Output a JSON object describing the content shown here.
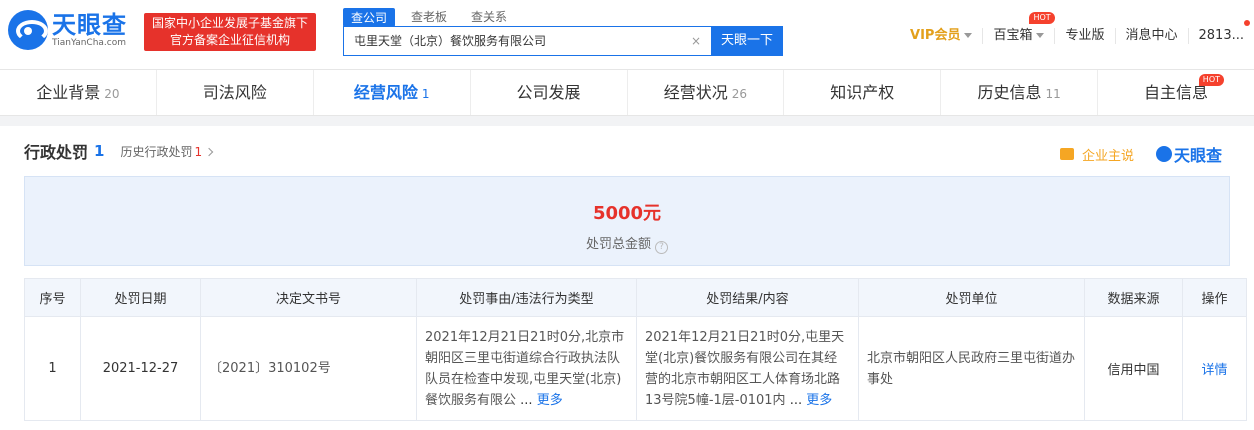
{
  "brand": {
    "name_cn": "天眼查",
    "name_en": "TianYanCha.com",
    "badge_line1": "国家中小企业发展子基金旗下",
    "badge_line2": "官方备案企业征信机构"
  },
  "search": {
    "tabs": [
      "查公司",
      "查老板",
      "查关系"
    ],
    "value": "屯里天堂（北京）餐饮服务有限公司",
    "button": "天眼一下",
    "clear": "×"
  },
  "topnav": {
    "vip": "VIP会员",
    "treasure": "百宝箱",
    "hot": "HOT",
    "pro": "专业版",
    "messages": "消息中心",
    "user": "2813..."
  },
  "tabs": [
    {
      "label": "企业背景",
      "count": "20"
    },
    {
      "label": "司法风险",
      "count": ""
    },
    {
      "label": "经营风险",
      "count": "1"
    },
    {
      "label": "公司发展",
      "count": ""
    },
    {
      "label": "经营状况",
      "count": "26"
    },
    {
      "label": "知识产权",
      "count": ""
    },
    {
      "label": "历史信息",
      "count": "11"
    },
    {
      "label": "自主信息",
      "count": ""
    }
  ],
  "section": {
    "title": "行政处罚",
    "count": "1",
    "history_label": "历史行政处罚",
    "history_count": "1",
    "ent_say": "企业主说",
    "logo": "天眼查"
  },
  "summary": {
    "amount": "5000元",
    "label": "处罚总金额",
    "help": "?"
  },
  "table": {
    "headers": [
      "序号",
      "处罚日期",
      "决定文书号",
      "处罚事由/违法行为类型",
      "处罚结果/内容",
      "处罚单位",
      "数据来源",
      "操作"
    ],
    "rows": [
      {
        "index": "1",
        "date": "2021-12-27",
        "doc_no": "〔2021〕310102号",
        "reason": "2021年12月21日21时0分,北京市朝阳区三里屯街道综合行政执法队队员在检查中发现,屯里天堂(北京)餐饮服务有限公",
        "result": "2021年12月21日21时0分,屯里天堂(北京)餐饮服务有限公司在其经营的北京市朝阳区工人体育场北路13号院5幢-1层-0101内",
        "authority": "北京市朝阳区人民政府三里屯街道办事处",
        "source": "信用中国",
        "action": "详情"
      }
    ],
    "ellipsis": "...",
    "more": "更多"
  }
}
